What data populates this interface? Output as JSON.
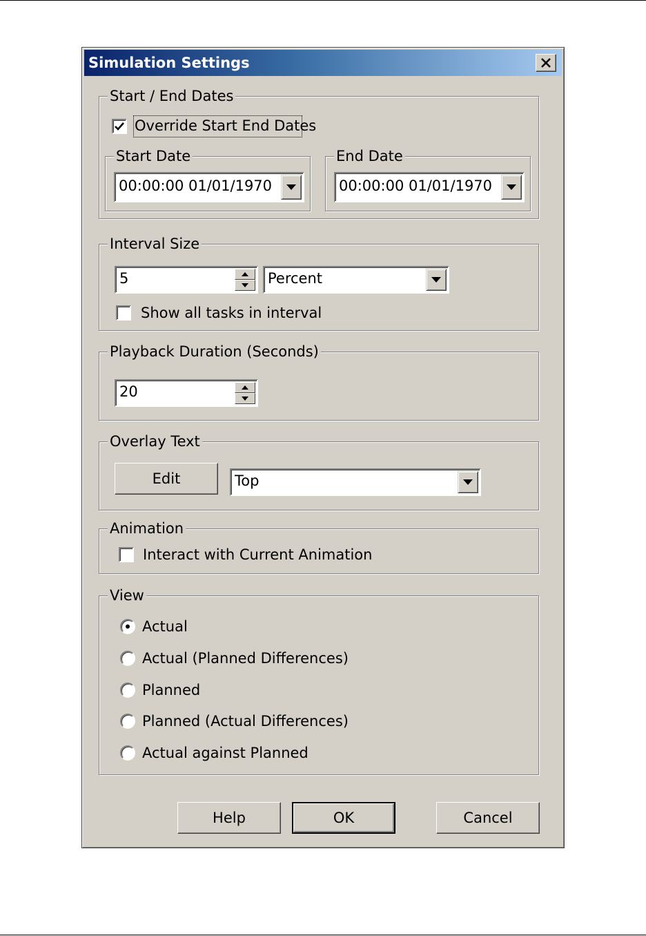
{
  "window": {
    "title": "Simulation Settings"
  },
  "start_end": {
    "group_label": "Start / End Dates",
    "override_label": "Override Start End Dates",
    "override_checked": true,
    "start_label": "Start Date",
    "start_value": "00:00:00 01/01/1970",
    "end_label": "End Date",
    "end_value": "00:00:00 01/01/1970"
  },
  "interval": {
    "group_label": "Interval Size",
    "size_value": "5",
    "unit_value": "Percent",
    "show_all_label": "Show all tasks in interval",
    "show_all_checked": false
  },
  "playback": {
    "group_label": "Playback Duration (Seconds)",
    "value": "20"
  },
  "overlay": {
    "group_label": "Overlay Text",
    "edit_label": "Edit",
    "position_value": "Top"
  },
  "animation": {
    "group_label": "Animation",
    "interact_label": "Interact with Current Animation",
    "interact_checked": false
  },
  "view": {
    "group_label": "View",
    "options": [
      {
        "label": "Actual",
        "selected": true
      },
      {
        "label": "Actual (Planned Differences)",
        "selected": false
      },
      {
        "label": "Planned",
        "selected": false
      },
      {
        "label": "Planned (Actual Differences)",
        "selected": false
      },
      {
        "label": "Actual against Planned",
        "selected": false
      }
    ]
  },
  "buttons": {
    "help": "Help",
    "ok": "OK",
    "cancel": "Cancel"
  }
}
